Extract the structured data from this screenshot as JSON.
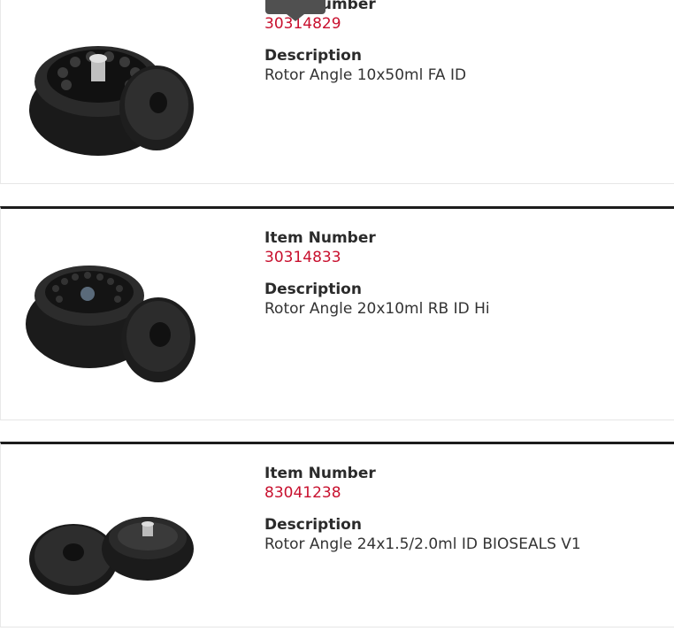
{
  "items": [
    {
      "label_item": "Item Number",
      "item_number": "30314829",
      "label_desc": "Description",
      "description": "Rotor Angle 10x50ml FA ID"
    },
    {
      "label_item": "Item Number",
      "item_number": "30314833",
      "label_desc": "Description",
      "description": "Rotor Angle 20x10ml RB ID Hi"
    },
    {
      "label_item": "Item Number",
      "item_number": "83041238",
      "label_desc": "Description",
      "description": "Rotor Angle 24x1.5/2.0ml ID BIOSEALS V1"
    }
  ],
  "colors": {
    "accent": "#c8102e",
    "border": "#1c1c1c"
  }
}
